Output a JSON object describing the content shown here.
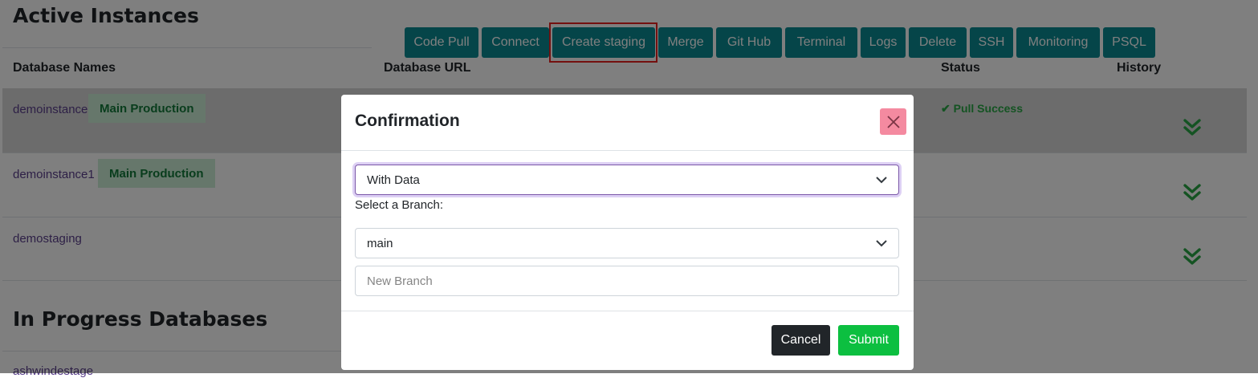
{
  "active_instances": {
    "title": "Active Instances",
    "toolbar": [
      {
        "label": "Code Pull"
      },
      {
        "label": "Connect"
      },
      {
        "label": "Create staging",
        "highlighted": true
      },
      {
        "label": "Merge"
      },
      {
        "label": "Git Hub"
      },
      {
        "label": "Terminal"
      },
      {
        "label": "Logs"
      },
      {
        "label": "Delete"
      },
      {
        "label": "SSH"
      },
      {
        "label": "Monitoring"
      },
      {
        "label": "PSQL"
      }
    ],
    "columns": {
      "names": "Database Names",
      "url": "Database URL",
      "status": "Status",
      "history": "History"
    },
    "rows": [
      {
        "name": "demoinstance",
        "badge": "Main Production",
        "status": "Pull Success",
        "selected": true,
        "history_icon": "double-chevron-down-icon"
      },
      {
        "name": "demoinstance1",
        "badge": "Main Production",
        "status": "",
        "selected": false,
        "history_icon": "double-chevron-down-icon"
      },
      {
        "name": "demostaging",
        "badge": "",
        "status": "",
        "selected": false,
        "history_icon": "double-chevron-down-icon"
      }
    ]
  },
  "in_progress": {
    "title": "In Progress Databases",
    "rows": [
      {
        "name": "ashwindestage"
      }
    ]
  },
  "modal": {
    "title": "Confirmation",
    "close_icon": "close-icon",
    "data_select": {
      "value": "With Data"
    },
    "branch_label": "Select a Branch:",
    "branch_select": {
      "value": "main"
    },
    "new_branch": {
      "placeholder": "New Branch",
      "value": ""
    },
    "cancel_label": "Cancel",
    "submit_label": "Submit"
  },
  "colors": {
    "toolbar_button": "#0b8a93",
    "highlight_box": "#e8201e",
    "badge_bg": "#cdeed6",
    "badge_text": "#137a3a",
    "success": "#28a745",
    "submit": "#0cbf40",
    "cancel": "#212529",
    "close_button": "#f48aa0"
  }
}
